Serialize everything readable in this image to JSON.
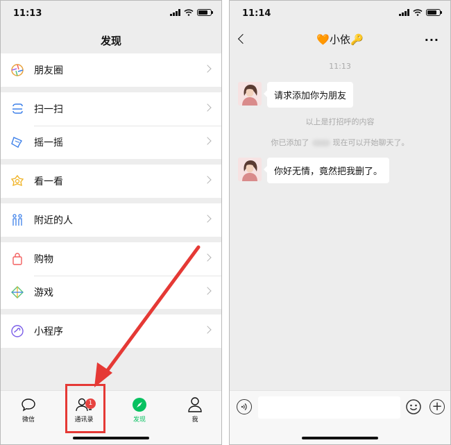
{
  "left_screen": {
    "status": {
      "time": "11:13"
    },
    "title": "发现",
    "menu_groups": [
      [
        {
          "label": "朋友圈",
          "icon": "moments-icon"
        }
      ],
      [
        {
          "label": "扫一扫",
          "icon": "scan-icon"
        },
        {
          "label": "摇一摇",
          "icon": "shake-icon"
        }
      ],
      [
        {
          "label": "看一看",
          "icon": "top-stories-icon"
        }
      ],
      [
        {
          "label": "附近的人",
          "icon": "people-nearby-icon"
        }
      ],
      [
        {
          "label": "购物",
          "icon": "shopping-bag-icon"
        },
        {
          "label": "游戏",
          "icon": "games-icon"
        }
      ],
      [
        {
          "label": "小程序",
          "icon": "mini-programs-icon"
        }
      ]
    ],
    "tabbar": {
      "tabs": [
        {
          "label": "微信",
          "icon": "chat-icon"
        },
        {
          "label": "通讯录",
          "icon": "contacts-icon",
          "badge": "1"
        },
        {
          "label": "发现",
          "icon": "discover-icon",
          "active": true
        },
        {
          "label": "我",
          "icon": "me-icon"
        }
      ]
    },
    "annotation_color": "#e53935"
  },
  "right_screen": {
    "status": {
      "time": "11:14"
    },
    "title": "🧡小依🔑",
    "timestamp": "11:13",
    "messages": [
      {
        "text": "请求添加你为朋友"
      },
      {
        "text": "你好无情，竟然把我删了。"
      }
    ],
    "system_notes": {
      "greeting_note": "以上是打招呼的内容",
      "added_prefix": "你已添加了",
      "added_suffix": "现在可以开始聊天了。"
    }
  },
  "colors": {
    "wechat_green": "#07c160",
    "badge_red": "#e64340",
    "background": "#ededed"
  }
}
